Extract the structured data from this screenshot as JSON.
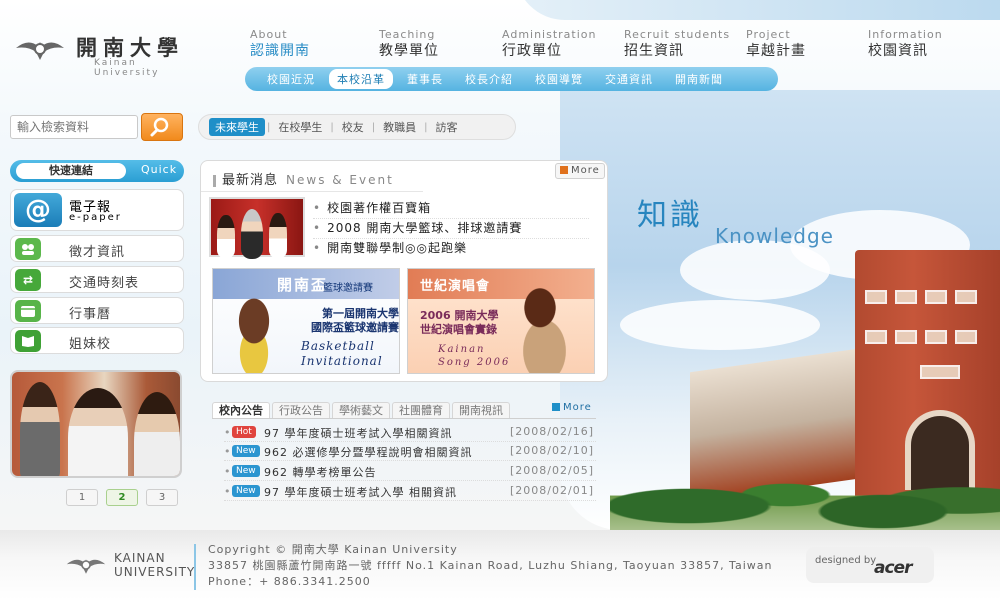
{
  "logo": {
    "name_cn": "開南大學",
    "name_en": "Kainan University"
  },
  "main_nav": [
    {
      "en": "About",
      "cn": "認識開南",
      "active": true
    },
    {
      "en": "Teaching",
      "cn": "教學單位",
      "active": false
    },
    {
      "en": "Administration",
      "cn": "行政單位",
      "active": false
    },
    {
      "en": "Recruit students",
      "cn": "招生資訊",
      "active": false
    },
    {
      "en": "Project",
      "cn": "卓越計畫",
      "active": false
    },
    {
      "en": "Information",
      "cn": "校園資訊",
      "active": false
    }
  ],
  "sub_nav": [
    "校園近況",
    "本校沿革",
    "董事長",
    "校長介紹",
    "校園導覽",
    "交通資訊",
    "開南新聞"
  ],
  "sub_nav_active": 1,
  "search": {
    "placeholder": "輸入檢索資料"
  },
  "audience_nav": [
    "未來學生",
    "在校學生",
    "校友",
    "教職員",
    "訪客"
  ],
  "quick_links": {
    "title_cn": "快速連結",
    "title_en": "Quick",
    "items": [
      {
        "label": "電子報",
        "sub": "e-paper",
        "icon": "at-icon"
      },
      {
        "label": "徵才資訊",
        "icon": "people-icon"
      },
      {
        "label": "交通時刻表",
        "icon": "arrows-icon"
      },
      {
        "label": "行事曆",
        "icon": "calendar-icon"
      },
      {
        "label": "姐妹校",
        "icon": "book-icon"
      }
    ]
  },
  "pager": [
    "1",
    "2",
    "3"
  ],
  "pager_active": 1,
  "news": {
    "title_cn": "最新消息",
    "title_en": "News & Event",
    "more": "More",
    "headlines": [
      "校園著作權百寶箱",
      "2008 開南大學籃球、排球邀請賽",
      "開南雙聯學制◎◎起跑樂"
    ],
    "banner1": {
      "title": "開南盃",
      "tag": "籃球邀請賽",
      "cn": "第一屆開南大學\n國際盃籃球邀請賽",
      "en": "Basketball\nInvitational"
    },
    "banner2": {
      "title": "世紀演唱會",
      "cn": "2006 開南大學\n世紀演唱會實錄",
      "en": "Kainan\nSong 2006"
    }
  },
  "announcements": {
    "tabs": [
      "校內公告",
      "行政公告",
      "學術藝文",
      "社團體育",
      "開南視訊"
    ],
    "more": "More",
    "rows": [
      {
        "badge": "Hot",
        "badge_type": "hot",
        "text": "97 學年度碩士班考試入學相關資訊",
        "date": "[2008/02/16]"
      },
      {
        "badge": "New",
        "badge_type": "new",
        "text": "962 必選修學分暨學程說明會相關資訊",
        "date": "[2008/02/10]"
      },
      {
        "badge": "New",
        "badge_type": "new",
        "text": "962 轉學考榜單公告",
        "date": "[2008/02/05]"
      },
      {
        "badge": "New",
        "badge_type": "new",
        "text": "97 學年度碩士班考試入學 相關資訊",
        "date": "[2008/02/01]"
      }
    ]
  },
  "hero": {
    "cn": "知識",
    "en": "Knowledge"
  },
  "footer": {
    "logo_line1": "KAINAN",
    "logo_line2": "UNIVERSITY",
    "copyright": "Copyright © 開南大學 Kainan University",
    "address": "33857 桃園縣蘆竹開南路一號 fffff No.1 Kainan Road, Luzhu Shiang, Taoyuan 33857, Taiwan",
    "phone": "Phone：+ 886.3341.2500",
    "designed_by": "designed by",
    "designer": "acer"
  }
}
